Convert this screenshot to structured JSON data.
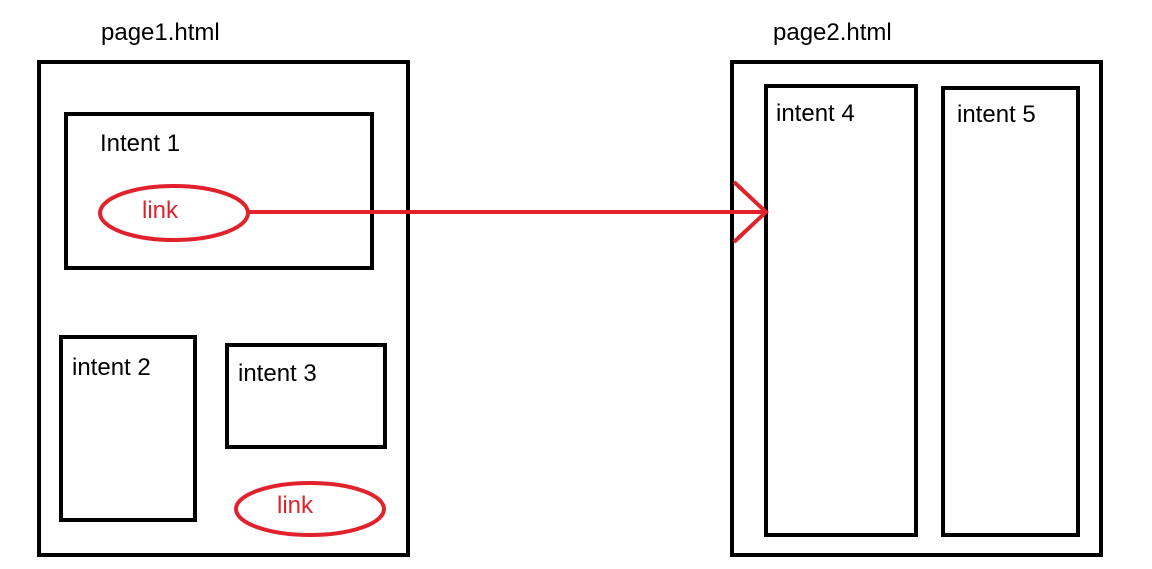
{
  "colors": {
    "box_border": "#000000",
    "link": "#e1212b"
  },
  "pages": [
    {
      "title": "page1.html",
      "sections": [
        {
          "label": "Intent 1"
        },
        {
          "label": "intent 2"
        },
        {
          "label": "intent 3"
        }
      ],
      "links": [
        {
          "label": "link"
        },
        {
          "label": "link"
        }
      ]
    },
    {
      "title": "page2.html",
      "sections": [
        {
          "label": "intent 4"
        },
        {
          "label": "intent 5"
        }
      ]
    }
  ]
}
